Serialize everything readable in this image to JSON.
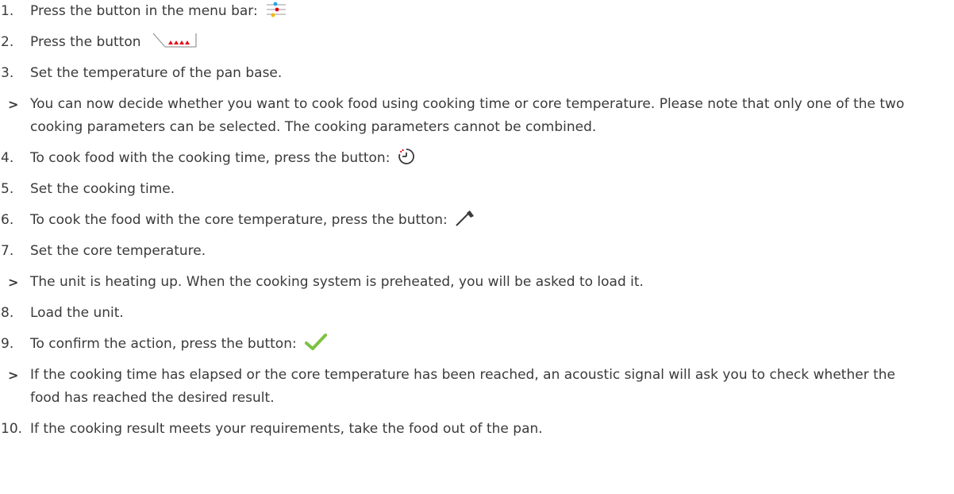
{
  "steps": [
    {
      "marker": "1.",
      "text": "Press the button in the menu bar:",
      "icon": "filter-settings-icon",
      "type": "step"
    },
    {
      "marker": "2.",
      "text": "Press the button",
      "icon": "pan-heat-icon",
      "type": "step"
    },
    {
      "marker": "3.",
      "text": "Set the temperature of the pan base.",
      "type": "step"
    },
    {
      "marker": ">",
      "text": "You can now decide whether you want to cook food using cooking time or core temperature. Please note that only one of the two cooking parameters can be selected. The cooking parameters cannot be combined.",
      "type": "result"
    },
    {
      "marker": "4.",
      "text": "To cook food with the cooking time, press the button:",
      "icon": "timer-icon",
      "type": "step"
    },
    {
      "marker": "5.",
      "text": "Set the cooking time.",
      "type": "step"
    },
    {
      "marker": "6.",
      "text": "To cook the food with the core temperature, press the button:",
      "icon": "core-probe-icon",
      "type": "step"
    },
    {
      "marker": "7.",
      "text": "Set the core temperature.",
      "type": "step"
    },
    {
      "marker": ">",
      "text": "The unit is heating up. When the cooking system is preheated, you will be asked to load it.",
      "type": "result"
    },
    {
      "marker": "8.",
      "text": "Load the unit.",
      "type": "step"
    },
    {
      "marker": "9.",
      "text": "To confirm the action, press the button:",
      "icon": "checkmark-icon",
      "type": "step"
    },
    {
      "marker": ">",
      "text": "If the cooking time has elapsed or the core temperature has been reached, an acoustic signal will ask you to check whether the food has reached the desired result.",
      "type": "result"
    },
    {
      "marker": "10.",
      "text": "If the cooking result meets your requirements, take the food out of the pan.",
      "type": "step"
    }
  ],
  "colors": {
    "text": "#3a3a3a",
    "check_green": "#7dc242",
    "heat_red": "#e30613",
    "accent_blue": "#1ea7e1",
    "accent_yellow": "#f7b500"
  }
}
